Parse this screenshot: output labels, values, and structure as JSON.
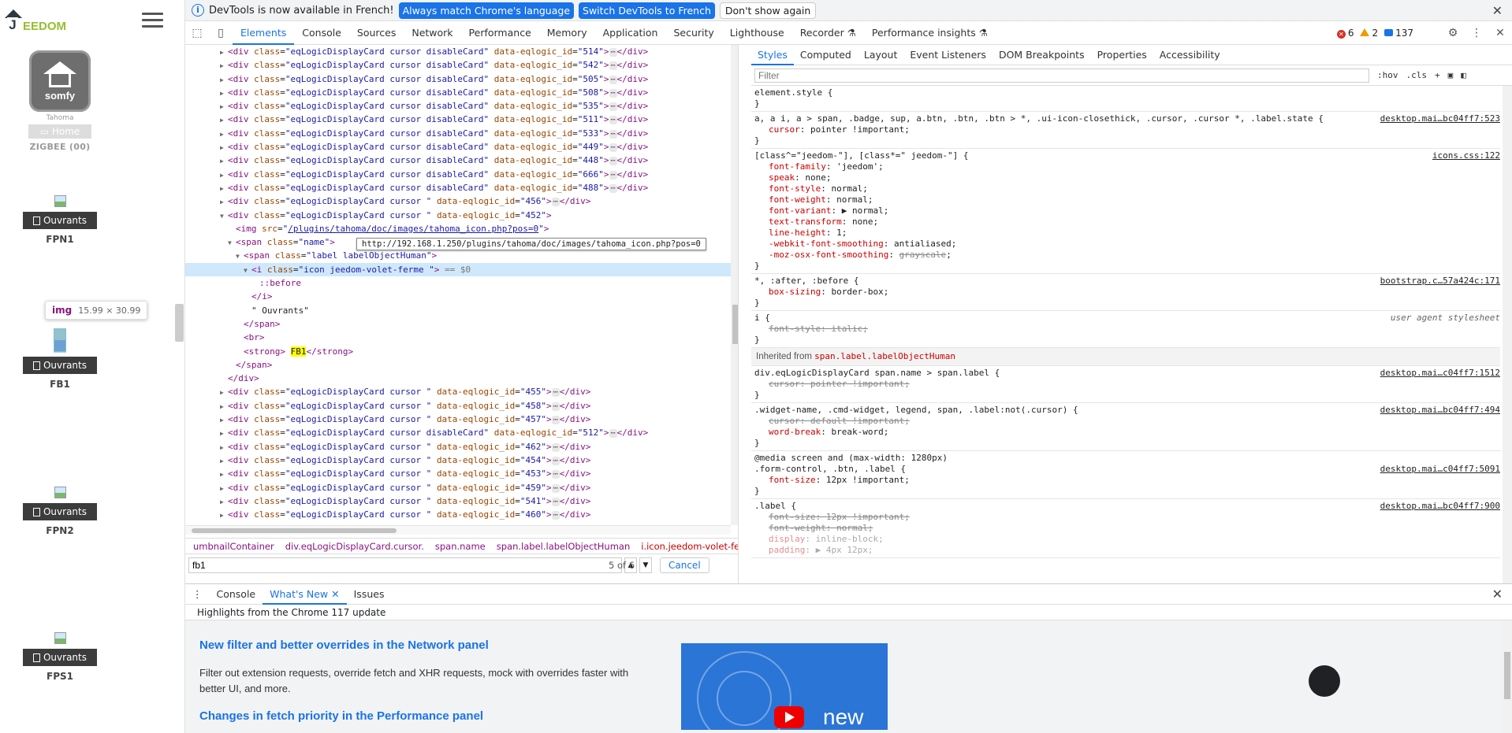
{
  "jeedom": {
    "logo": "EEDOM",
    "plugin_card": {
      "brand": "somfy",
      "caption": "Tahoma",
      "home": "Home",
      "zigbee": "ZIGBEE (00)"
    },
    "cards": [
      {
        "label": "Ouvrants",
        "name": "FPN1"
      },
      {
        "label": "Ouvrants",
        "name": "FB1"
      },
      {
        "label": "Ouvrants",
        "name": "FPN2"
      },
      {
        "label": "Ouvrants",
        "name": "FPS1"
      }
    ],
    "tooltip": {
      "tag": "img",
      "size": "15.99 × 30.99"
    }
  },
  "infobar": {
    "message": "DevTools is now available in French!",
    "btn_match": "Always match Chrome's language",
    "btn_switch": "Switch DevTools to French",
    "btn_dismiss": "Don't show again"
  },
  "tabs": [
    "Elements",
    "Console",
    "Sources",
    "Network",
    "Performance",
    "Memory",
    "Application",
    "Security",
    "Lighthouse",
    "Recorder ⚗",
    "Performance insights ⚗"
  ],
  "counters": {
    "errors": "6",
    "warnings": "2",
    "messages": "137"
  },
  "tree": {
    "collapsed_disabled": [
      {
        "id": "514"
      },
      {
        "id": "542"
      },
      {
        "id": "505"
      },
      {
        "id": "508"
      },
      {
        "id": "535"
      },
      {
        "id": "511"
      },
      {
        "id": "533"
      },
      {
        "id": "449"
      },
      {
        "id": "448"
      },
      {
        "id": "666"
      },
      {
        "id": "488"
      }
    ],
    "row_456": "456",
    "row_452": "452",
    "img_src": "/plugins/tahoma/doc/images/tahoma_icon.php?pos=0",
    "url_tooltip": "http://192.168.1.250/plugins/tahoma/doc/images/tahoma_icon.php?pos=0",
    "span_name": "name",
    "span_label": "label labelObjectHuman",
    "i_class": "icon jeedom-volet-ferme ",
    "eq0": "== $0",
    "before": "::before",
    "text_node": "\" Ouvrants\"",
    "strong_text": "FB1",
    "after": [
      {
        "id": "455",
        "dis": false
      },
      {
        "id": "458",
        "dis": false
      },
      {
        "id": "457",
        "dis": false
      },
      {
        "id": "512",
        "dis": true
      },
      {
        "id": "462",
        "dis": false
      },
      {
        "id": "454",
        "dis": false
      },
      {
        "id": "453",
        "dis": false
      },
      {
        "id": "459",
        "dis": false
      },
      {
        "id": "541",
        "dis": false
      },
      {
        "id": "460",
        "dis": false
      }
    ]
  },
  "breadcrumbs": [
    "umbnailContainer",
    "div.eqLogicDisplayCard.cursor.",
    "span.name",
    "span.label.labelObjectHuman",
    "i.icon.jeedom-volet-ferme."
  ],
  "search": {
    "value": "fb1",
    "count": "5 of 6",
    "cancel": "Cancel"
  },
  "styles": {
    "subtabs": [
      "Styles",
      "Computed",
      "Layout",
      "Event Listeners",
      "DOM Breakpoints",
      "Properties",
      "Accessibility"
    ],
    "filter_placeholder": "Filter",
    "hov": ":hov",
    "cls": ".cls",
    "inherited_label": "Inherited from ",
    "inherited_from": "span.label.labelObjectHuman"
  },
  "drawer": {
    "tabs": [
      "Console",
      "What's New",
      "Issues"
    ],
    "highlights": "Highlights from the Chrome 117 update",
    "h1": "New filter and better overrides in the Network panel",
    "p1": "Filter out extension requests, override fetch and XHR requests, mock with overrides faster with better UI, and more.",
    "h2": "Changes in fetch priority in the Performance panel",
    "video_text": "new"
  }
}
